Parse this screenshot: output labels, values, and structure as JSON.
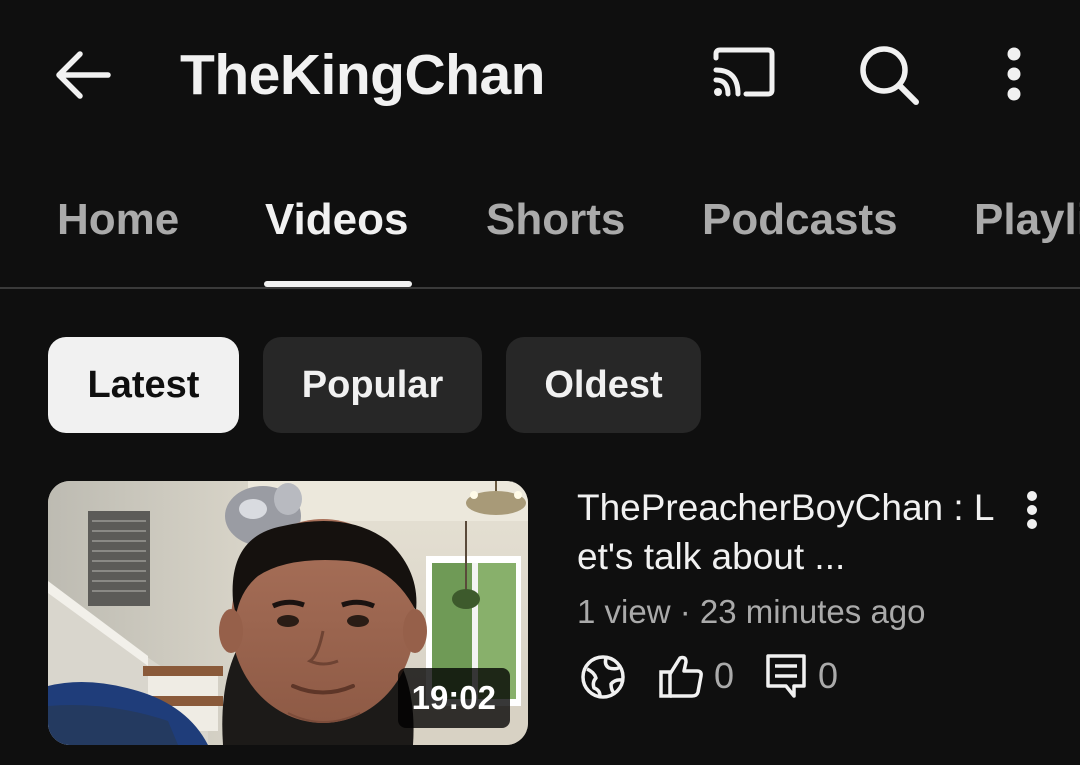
{
  "header": {
    "channel_name": "TheKingChan",
    "icons": [
      "back-arrow-icon",
      "cast-icon",
      "search-icon",
      "more-vert-icon"
    ]
  },
  "tabs": [
    {
      "label": "Home",
      "active": false
    },
    {
      "label": "Videos",
      "active": true
    },
    {
      "label": "Shorts",
      "active": false
    },
    {
      "label": "Podcasts",
      "active": false
    },
    {
      "label": "Playlists",
      "active": false
    }
  ],
  "filters": [
    {
      "label": "Latest",
      "selected": true
    },
    {
      "label": "Popular",
      "selected": false
    },
    {
      "label": "Oldest",
      "selected": false
    }
  ],
  "video": {
    "title": "ThePreacherBoyChan : Let's talk about ...",
    "duration": "19:02",
    "meta": "1 view · 23 minutes ago",
    "visibility_icon": "globe-icon",
    "likes": "0",
    "comments": "0"
  },
  "colors": {
    "background": "#0f0f0f",
    "text_primary": "#f1f1f1",
    "text_secondary": "#aaaaaa",
    "chip_bg": "#272727",
    "chip_selected_bg": "#f1f1f1"
  }
}
